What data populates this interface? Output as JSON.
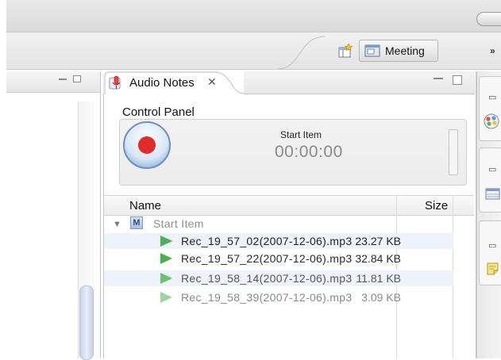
{
  "toolbar": {
    "open_perspective_icon": "open-perspective-icon",
    "perspective_label": "Meeting",
    "perspective_icon": "meeting-perspective-icon",
    "overflow_label": "»"
  },
  "audio_view": {
    "title": "Audio Notes",
    "tab_icon": "microphone-icon",
    "close_label": "✕",
    "control_panel_label": "Control Panel",
    "status_title": "Start Item",
    "status_time": "00:00:00",
    "record_color": "#e02c2c"
  },
  "table": {
    "columns": [
      "Name",
      "Size"
    ],
    "group": {
      "badge": "M",
      "label": "Start Item"
    },
    "rows": [
      {
        "name": "Rec_19_57_02(2007-12-06).mp3",
        "size": "23.27 KB"
      },
      {
        "name": "Rec_19_57_22(2007-12-06).mp3",
        "size": "32.84 KB"
      },
      {
        "name": "Rec_19_58_14(2007-12-06).mp3",
        "size": "11.81 KB"
      },
      {
        "name": "Rec_19_58_39(2007-12-06).mp3",
        "size": "3.09 KB"
      }
    ]
  },
  "right_stack": {
    "icons": [
      "restore-icon",
      "color-palette-icon",
      "restore-icon",
      "table-icon",
      "restore-icon",
      "note-icon"
    ]
  },
  "colors": {
    "play_green": "#4caf50",
    "row_highlight": "#eef3fb"
  }
}
